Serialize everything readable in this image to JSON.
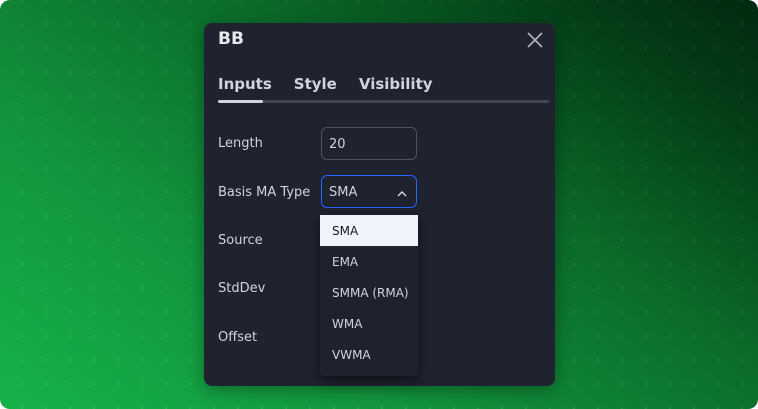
{
  "dialog": {
    "title": "BB",
    "tabs": [
      {
        "label": "Inputs",
        "active": true
      },
      {
        "label": "Style",
        "active": false
      },
      {
        "label": "Visibility",
        "active": false
      }
    ]
  },
  "inputs": {
    "length": {
      "label": "Length",
      "value": "20"
    },
    "basis_ma_type": {
      "label": "Basis MA Type",
      "value": "SMA"
    },
    "source": {
      "label": "Source"
    },
    "stddev": {
      "label": "StdDev"
    },
    "offset": {
      "label": "Offset"
    }
  },
  "dropdown": {
    "options": [
      "SMA",
      "EMA",
      "SMMA (RMA)",
      "WMA",
      "VWMA"
    ],
    "selected": "SMA"
  },
  "icons": {
    "close": "close-icon",
    "chevron": "chevron-up-icon"
  },
  "colors": {
    "accent": "#2962ff",
    "panel": "#1f2330"
  }
}
